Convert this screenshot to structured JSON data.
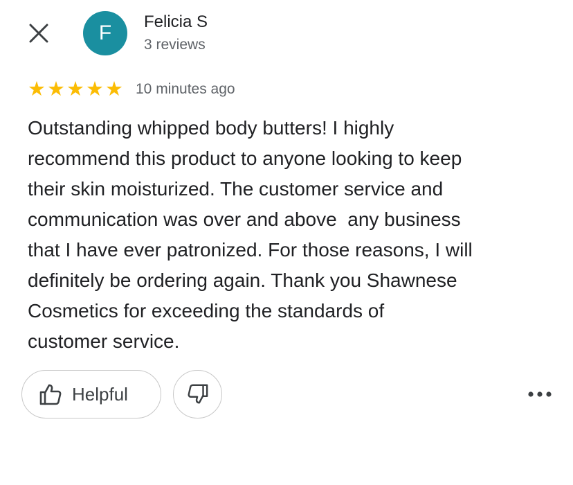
{
  "reviewer": {
    "avatar_initial": "F",
    "avatar_color": "#1a8fa0",
    "name": "Felicia S",
    "review_count": "3 reviews"
  },
  "rating": {
    "stars": 5,
    "max_stars": 5,
    "star_color": "#fbbc04",
    "timestamp": "10 minutes ago"
  },
  "review_text": "Outstanding whipped body butters! I highly\nrecommend this product to anyone looking to keep\ntheir skin moisturized. The customer service and\ncommunication was over and above  any business\nthat I have ever patronized. For those reasons, I will\ndefinitely be ordering again. Thank you Shawnese\nCosmetics for exceeding the standards of\ncustomer service.",
  "actions": {
    "helpful_label": "Helpful",
    "icons": [
      "close-icon",
      "thumbs-up-icon",
      "thumbs-down-icon",
      "more-horizontal-icon"
    ]
  }
}
